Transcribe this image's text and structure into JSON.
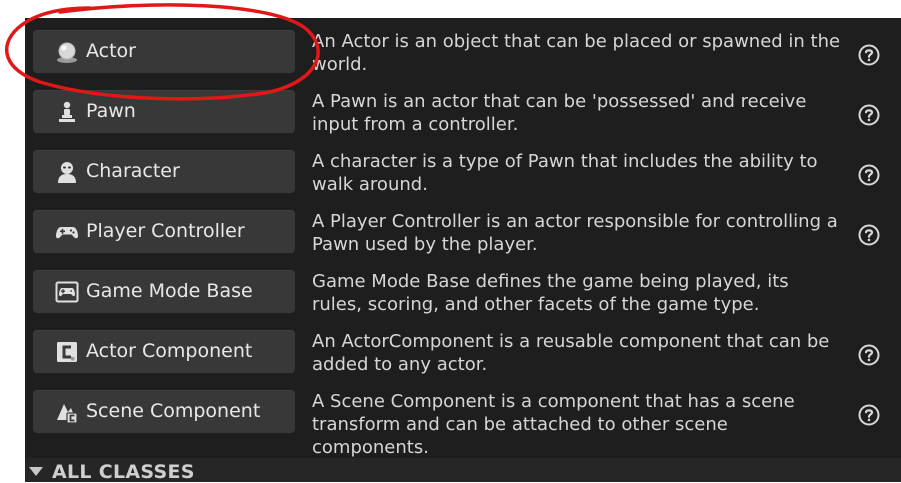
{
  "colors": {
    "panel_background": "#1e1e1e",
    "button_background": "#383838",
    "text": "#d6d6d6",
    "annotation": "#e01818"
  },
  "classes": [
    {
      "label": "Actor",
      "icon": "actor-sphere-icon",
      "description": "An Actor is an object that can be placed or spawned in the world.",
      "help_icon": "question-circle-icon"
    },
    {
      "label": "Pawn",
      "icon": "pawn-icon",
      "description": "A Pawn is an actor that can be 'possessed' and receive input from a controller.",
      "help_icon": "question-circle-icon"
    },
    {
      "label": "Character",
      "icon": "character-icon",
      "description": "A character is a type of Pawn that includes the ability to walk around.",
      "help_icon": "question-circle-icon"
    },
    {
      "label": "Player Controller",
      "icon": "gamepad-icon",
      "description": "A Player Controller is an actor responsible for controlling a Pawn used by the player.",
      "help_icon": "question-circle-icon"
    },
    {
      "label": "Game Mode Base",
      "icon": "game-mode-icon",
      "description": "Game Mode Base defines the game being played, its rules, scoring, and other facets of the game type.",
      "help_icon": null
    },
    {
      "label": "Actor Component",
      "icon": "actor-component-icon",
      "description": "An ActorComponent is a reusable component that can be added to any actor.",
      "help_icon": "question-circle-icon"
    },
    {
      "label": "Scene Component",
      "icon": "scene-component-icon",
      "description": "A Scene Component is a component that has a scene transform and can be attached to other scene components.",
      "help_icon": "question-circle-icon"
    }
  ],
  "all_classes": {
    "label": "ALL CLASSES",
    "icon": "triangle-down-icon"
  }
}
